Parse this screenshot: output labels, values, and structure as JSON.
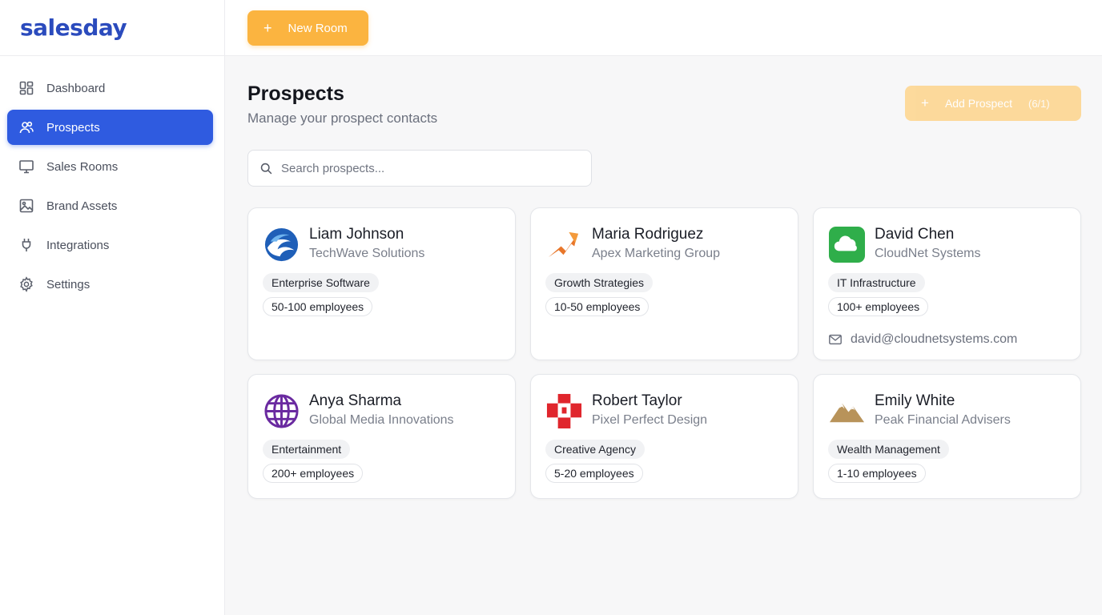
{
  "brand": {
    "name": "salesday"
  },
  "sidebar": {
    "items": [
      {
        "label": "Dashboard",
        "icon": "dashboard-icon",
        "active": false
      },
      {
        "label": "Prospects",
        "icon": "users-icon",
        "active": true
      },
      {
        "label": "Sales Rooms",
        "icon": "monitor-icon",
        "active": false
      },
      {
        "label": "Brand Assets",
        "icon": "image-icon",
        "active": false
      },
      {
        "label": "Integrations",
        "icon": "plug-icon",
        "active": false
      },
      {
        "label": "Settings",
        "icon": "gear-icon",
        "active": false
      }
    ]
  },
  "topbar": {
    "new_room_label": "New Room"
  },
  "page": {
    "title": "Prospects",
    "subtitle": "Manage your prospect contacts",
    "add_prospect_label": "Add Prospect",
    "add_prospect_count": "(6/1)"
  },
  "search": {
    "placeholder": "Search prospects..."
  },
  "prospects": [
    {
      "name": "Liam Johnson",
      "company": "TechWave Solutions",
      "industry": "Enterprise Software",
      "size": "50-100 employees",
      "logo": "wave-logo-icon",
      "email": ""
    },
    {
      "name": "Maria Rodriguez",
      "company": "Apex Marketing Group",
      "industry": "Growth Strategies",
      "size": "10-50 employees",
      "logo": "arrow-logo-icon",
      "email": ""
    },
    {
      "name": "David Chen",
      "company": "CloudNet Systems",
      "industry": "IT Infrastructure",
      "size": "100+ employees",
      "logo": "cloud-logo-icon",
      "email": "david@cloudnetsystems.com"
    },
    {
      "name": "Anya Sharma",
      "company": "Global Media Innovations",
      "industry": "Entertainment",
      "size": "200+ employees",
      "logo": "globe-logo-icon",
      "email": ""
    },
    {
      "name": "Robert Taylor",
      "company": "Pixel Perfect Design",
      "industry": "Creative Agency",
      "size": "5-20 employees",
      "logo": "pixel-logo-icon",
      "email": ""
    },
    {
      "name": "Emily White",
      "company": "Peak Financial Advisers",
      "industry": "Wealth Management",
      "size": "1-10 employees",
      "logo": "mountain-logo-icon",
      "email": ""
    }
  ],
  "colors": {
    "brand": "#2b4bbd",
    "accent_active": "#2f5be0",
    "accent_orange": "#fbb440"
  }
}
